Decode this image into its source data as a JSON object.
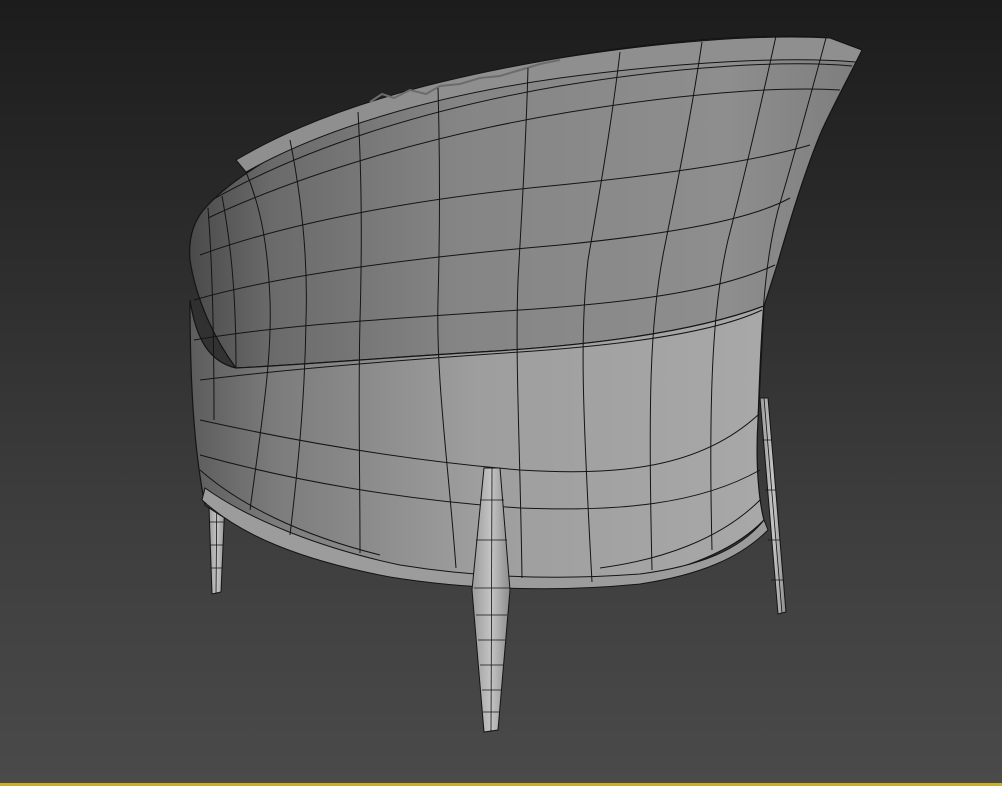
{
  "viewport": {
    "background_top": "#1c1c1c",
    "background_bottom": "#4a4a4a",
    "active_border_color": "#c9b02a"
  },
  "model": {
    "object": "armchair-wireframe",
    "shading": "smooth-with-edged-faces",
    "surface_color": "#8a8a8a",
    "wire_color": "#141414"
  }
}
